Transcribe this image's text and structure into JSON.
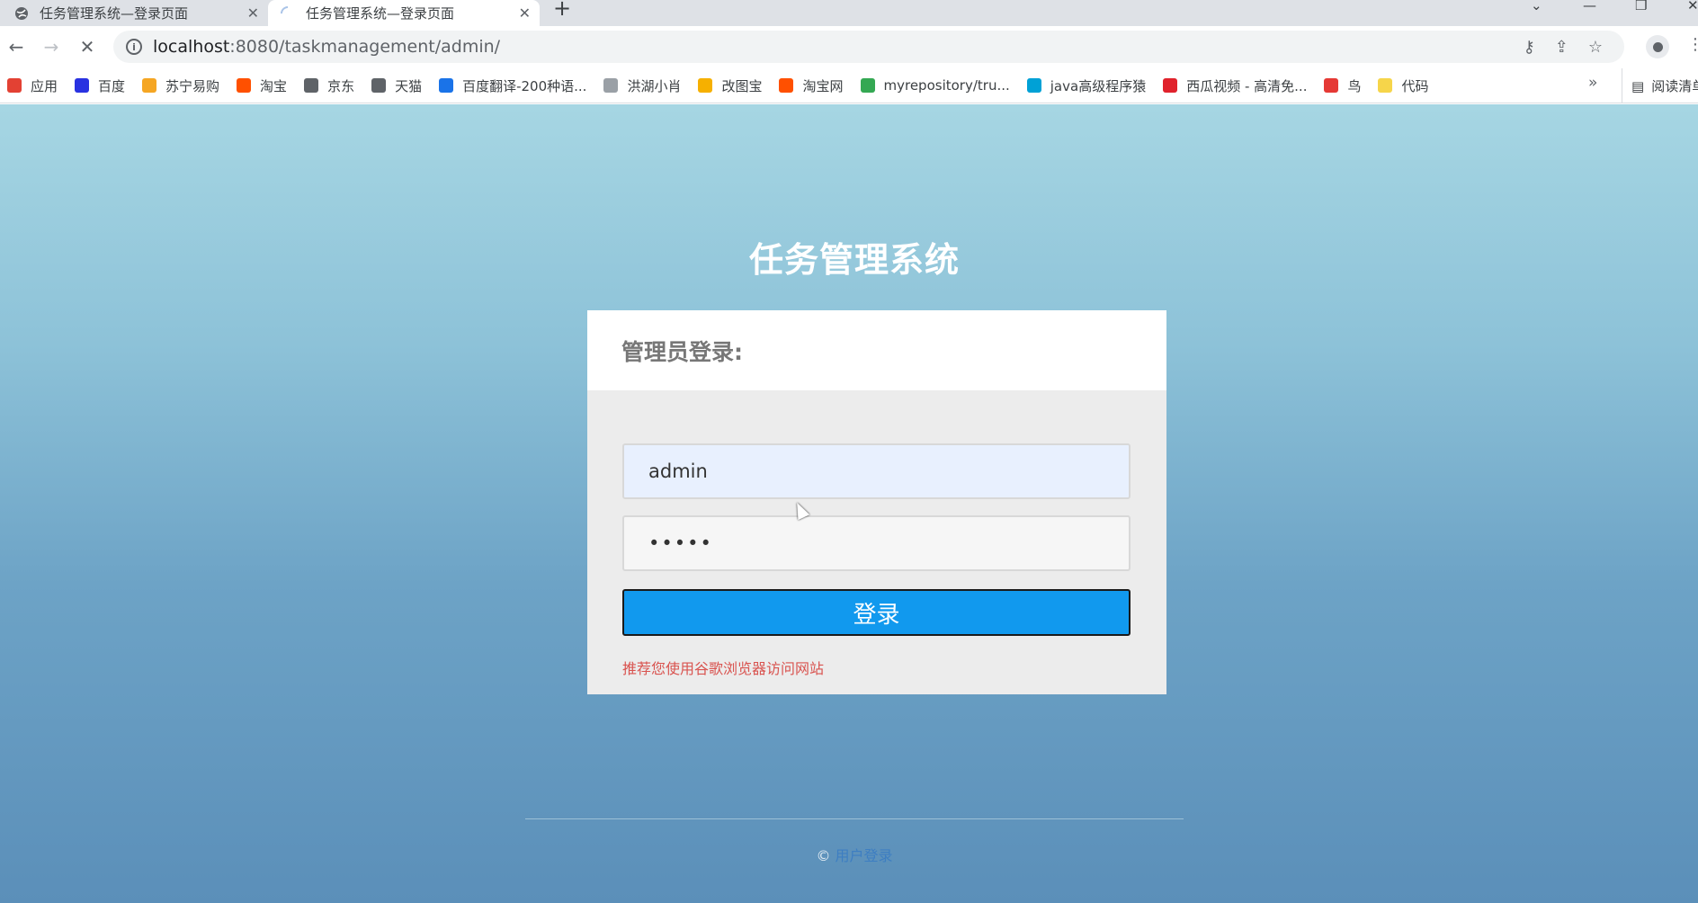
{
  "tabs": [
    {
      "title": "任务管理系统—登录页面",
      "active": false
    },
    {
      "title": "任务管理系统—登录页面",
      "active": true
    }
  ],
  "toolbar": {
    "url_host": "localhost",
    "url_path": ":8080/taskmanagement/admin/"
  },
  "bookmarks": [
    {
      "label": "应用",
      "icon": "apps-grid-icon",
      "color": "#e34133"
    },
    {
      "label": "百度",
      "icon": "baidu-paw-icon",
      "color": "#2932e1"
    },
    {
      "label": "苏宁易购",
      "icon": "suning-icon",
      "color": "#f5a623"
    },
    {
      "label": "淘宝",
      "icon": "taobao-icon",
      "color": "#ff5000"
    },
    {
      "label": "京东",
      "icon": "globe-icon",
      "color": "#5f6368"
    },
    {
      "label": "天猫",
      "icon": "globe-icon",
      "color": "#5f6368"
    },
    {
      "label": "百度翻译-200种语...",
      "icon": "translate-icon",
      "color": "#1a73e8"
    },
    {
      "label": "洪湖小肖",
      "icon": "bird-icon",
      "color": "#9aa0a6"
    },
    {
      "label": "改图宝",
      "icon": "gaitubao-icon",
      "color": "#f6b000"
    },
    {
      "label": "淘宝网",
      "icon": "taobao-icon",
      "color": "#ff5000"
    },
    {
      "label": "myrepository/tru...",
      "icon": "chrome-icon",
      "color": "#34a853"
    },
    {
      "label": "java高级程序猿",
      "icon": "bilibili-icon",
      "color": "#00a1d6"
    },
    {
      "label": "西瓜视频 - 高清免...",
      "icon": "xigua-icon",
      "color": "#e0222c"
    },
    {
      "label": "鸟",
      "icon": "bird-icon",
      "color": "#e53935"
    },
    {
      "label": "代码",
      "icon": "leaf-icon",
      "color": "#f6d54a"
    }
  ],
  "bookmarks_more": "»",
  "reading_list": "阅读清单",
  "page": {
    "title": "任务管理系统",
    "card_heading": "管理员登录:",
    "username_value": "admin",
    "password_value": "•••••",
    "login_label": "登录",
    "hint": "推荐您使用谷歌浏览器访问网站",
    "footer_symbol": "©",
    "footer_link": "用户登录"
  },
  "colors": {
    "button": "#1199ee",
    "hint": "#d9534f",
    "link": "#3d7ec2"
  }
}
